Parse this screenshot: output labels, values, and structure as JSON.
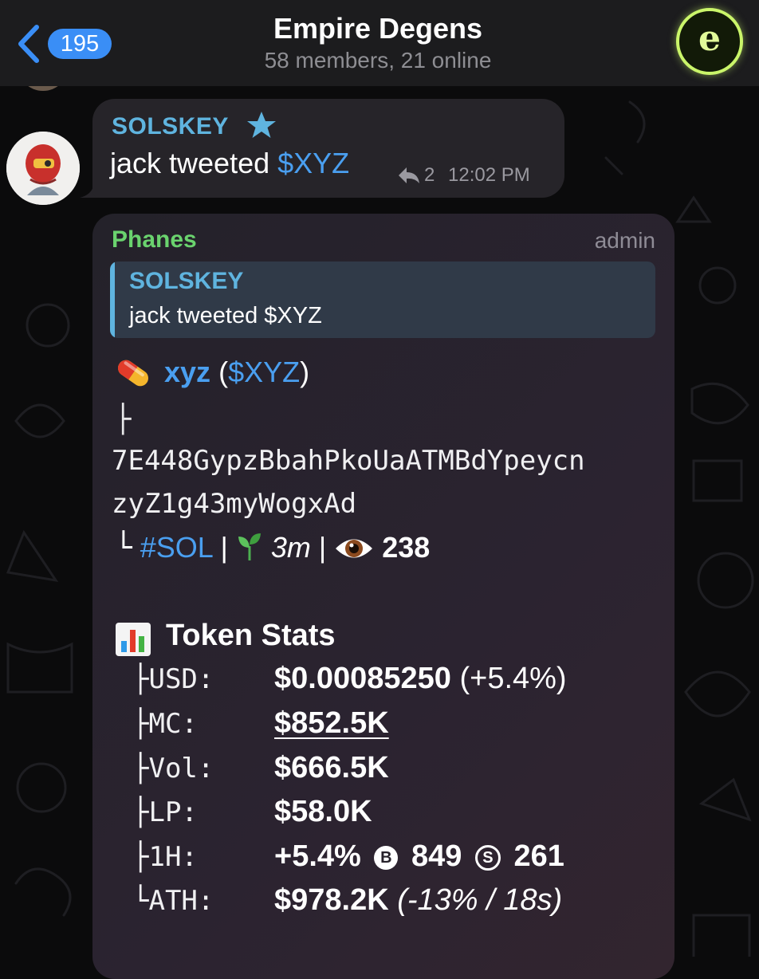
{
  "header": {
    "back_count": "195",
    "title": "Empire Degens",
    "subtitle": "58 members, 21 online",
    "avatar_letter": "e",
    "avatar_color": "#caf56a"
  },
  "messages": [
    {
      "sender": "SOLSKEY",
      "text": "jack tweeted ",
      "tag": "$XYZ",
      "reply_count": "2",
      "time": "12:02 PM"
    },
    {
      "sender": "Phanes",
      "role": "admin",
      "quote": {
        "sender": "SOLSKEY",
        "text": "jack tweeted $XYZ"
      },
      "token": {
        "name": "xyz",
        "ticker": "$XYZ",
        "branch": "├",
        "address_line1": "7E448GypzBbahPkoUaATMBdYpeycn",
        "address_line2": "zyZ1g43myWogxAd",
        "end_branch": "└",
        "chain": "#SOL",
        "sep": "|",
        "age": "3m",
        "views": "238"
      },
      "stats": {
        "title": "Token Stats",
        "usd_key": "├USD:",
        "usd_val": "$0.00085250",
        "usd_change": "(+5.4%)",
        "mc_key": "├MC:",
        "mc_val": "$852.5K",
        "vol_key": "├Vol:",
        "vol_val": "$666.5K",
        "lp_key": "├LP:",
        "lp_val": "$58.0K",
        "h1_key": "├1H:",
        "h1_change": "+5.4%",
        "h1_buy_icon": "B",
        "h1_buys": "849",
        "h1_sell_icon": "S",
        "h1_sells": "261",
        "ath_key": "└ATH:",
        "ath_val": "$978.2K",
        "ath_note": "(-13% / 18s)"
      }
    }
  ],
  "icons": {
    "back": "chevron-left-icon",
    "star": "star-icon",
    "reply": "reply-icon",
    "pill": "pill-icon",
    "sprout": "sprout-icon",
    "eye": "eye-icon",
    "chart": "bar-chart-icon"
  }
}
